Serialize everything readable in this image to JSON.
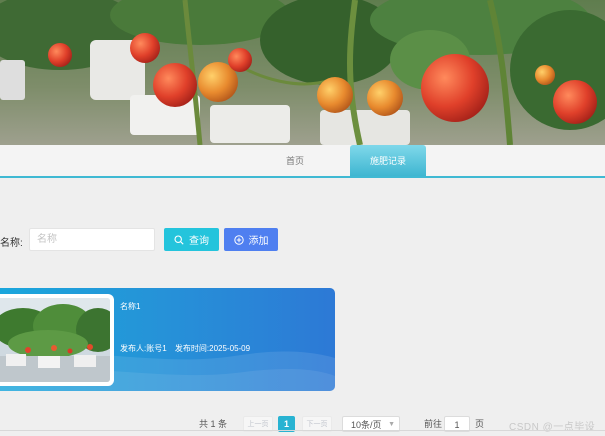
{
  "nav": {
    "items": [
      {
        "label": "首页"
      },
      {
        "label": "施肥记录"
      }
    ],
    "active_index": 1,
    "accent": "#3fb9d3"
  },
  "search": {
    "label": "名称:",
    "placeholder": "名称",
    "value": "",
    "query_button": "查询",
    "query_icon": "search-icon",
    "add_button": "添加",
    "add_icon": "plus-circle-icon",
    "query_color": "#24c4dc",
    "add_color": "#4f7ff0"
  },
  "card": {
    "title": "名称1",
    "publisher_label": "发布人:",
    "publisher": "账号1",
    "published_label": "发布时间:",
    "published_at": "2025-05-09"
  },
  "pagination": {
    "total": "共 1 条",
    "prev": "上一页",
    "current_page": "1",
    "next": "下一页",
    "page_size": "10条/页",
    "goto_label": "前往",
    "goto_value": "1",
    "page_unit": "页"
  },
  "watermark": "CSDN @一点毕设"
}
